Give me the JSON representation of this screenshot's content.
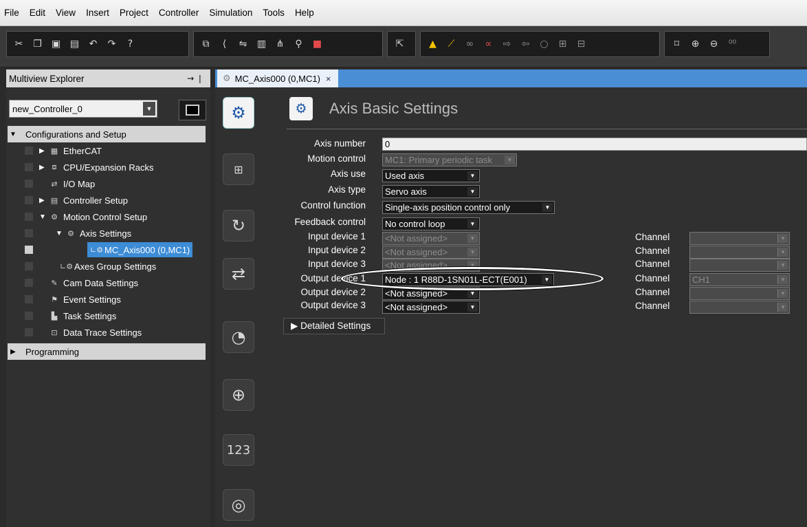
{
  "menu": [
    {
      "label": "File",
      "name": "menu-file"
    },
    {
      "label": "Edit",
      "name": "menu-edit"
    },
    {
      "label": "View",
      "name": "menu-view"
    },
    {
      "label": "Insert",
      "name": "menu-insert"
    },
    {
      "label": "Project",
      "name": "menu-project"
    },
    {
      "label": "Controller",
      "name": "menu-controller"
    },
    {
      "label": "Simulation",
      "name": "menu-simulation"
    },
    {
      "label": "Tools",
      "name": "menu-tools"
    },
    {
      "label": "Help",
      "name": "menu-help"
    }
  ],
  "toolbar": {
    "group1": [
      "cut-icon",
      "copy-icon",
      "paste-icon",
      "delete-icon",
      "undo-icon",
      "redo-icon",
      "help-icon"
    ],
    "group2": [
      "new-window-icon",
      "tool-icon",
      "compare-icon",
      "library-icon",
      "variables-icon",
      "find-icon",
      "stop-icon"
    ],
    "group3": [
      "build-icon"
    ],
    "group4": [
      "warning-icon",
      "wand-icon",
      "link-icon",
      "unlink-icon",
      "transfer-icon",
      "transfer-from-icon",
      "online-icon",
      "monitor-icon",
      "fit-icon"
    ],
    "group5": [
      "zoom-fit-icon",
      "zoom-in-icon",
      "zoom-out-icon",
      "zoom-100-icon"
    ]
  },
  "explorer": {
    "title": "Multiview Explorer",
    "pin": "→ ❘",
    "controller": "new_Controller_0",
    "tree": {
      "configurations": "Configurations and Setup",
      "ethercat": "EtherCAT",
      "cpu": "CPU/Expansion Racks",
      "io_map": "I/O Map",
      "controller_setup": "Controller Setup",
      "motion_control": "Motion Control Setup",
      "axis_settings": "Axis Settings",
      "mc_axis": "MC_Axis000 (0,MC1)",
      "axes_group": "Axes Group Settings",
      "cam_data": "Cam Data Settings",
      "event_settings": "Event Settings",
      "task_settings": "Task Settings",
      "data_trace": "Data Trace Settings",
      "programming": "Programming"
    }
  },
  "tab": {
    "label": "MC_Axis000 (0,MC1)",
    "close": "×"
  },
  "editor": {
    "title": "Axis Basic Settings",
    "fields": {
      "axis_number_label": "Axis number",
      "axis_number": "0",
      "motion_control_label": "Motion control",
      "motion_control": "MC1: Primary periodic task",
      "axis_use_label": "Axis use",
      "axis_use": "Used axis",
      "axis_type_label": "Axis type",
      "axis_type": "Servo axis",
      "control_function_label": "Control function",
      "control_function": "Single-axis position control only",
      "feedback_control_label": "Feedback control",
      "feedback_control": "No control loop",
      "input1_label": "Input device 1",
      "input1": "<Not assigned>",
      "input2_label": "Input device 2",
      "input2": "<Not assigned>",
      "input3_label": "Input device 3",
      "input3": "<Not assigned>",
      "output1_label": "Output device 1",
      "output1": "Node : 1 R88D-1SN01L-ECT(E001)",
      "output2_label": "Output device 2",
      "output2": "<Not assigned>",
      "output3_label": "Output device 3",
      "output3": "<Not assigned>",
      "channel_label": "Channel",
      "channel_output1": "CH1"
    },
    "detailed": "▶ Detailed Settings"
  }
}
